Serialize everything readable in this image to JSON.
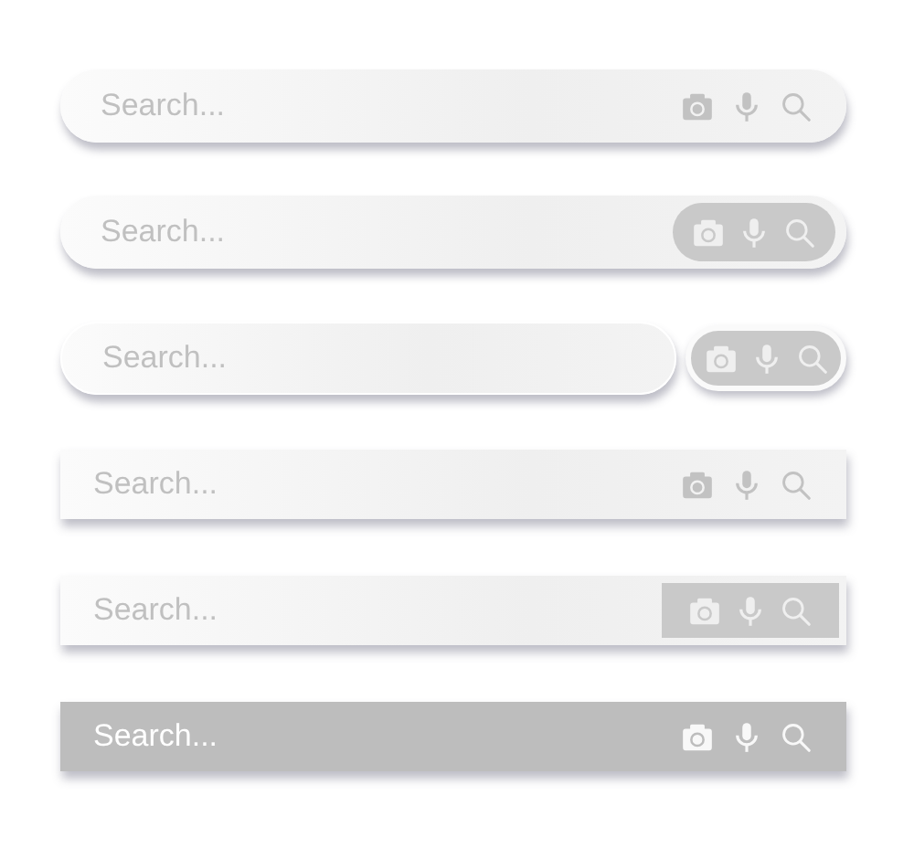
{
  "search_bars": [
    {
      "kind": "rounded",
      "placeholder": "Search..."
    },
    {
      "kind": "rounded-pill",
      "placeholder": "Search..."
    },
    {
      "kind": "rounded-split",
      "placeholder": "Search..."
    },
    {
      "kind": "square",
      "placeholder": "Search..."
    },
    {
      "kind": "square-block",
      "placeholder": "Search..."
    },
    {
      "kind": "filled",
      "placeholder": "Search..."
    }
  ]
}
